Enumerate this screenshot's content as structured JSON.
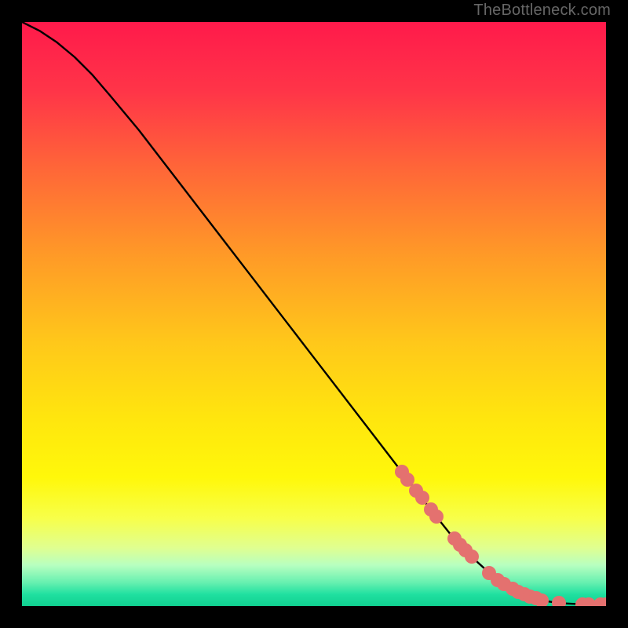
{
  "watermark": "TheBottleneck.com",
  "colors": {
    "page_bg": "#000000",
    "watermark": "#666666",
    "curve": "#000000",
    "marker": "#e4716f",
    "gradient_stops": [
      {
        "pct": 0,
        "color": "#ff1a4b"
      },
      {
        "pct": 12,
        "color": "#ff3548"
      },
      {
        "pct": 25,
        "color": "#ff6638"
      },
      {
        "pct": 40,
        "color": "#ff9a27"
      },
      {
        "pct": 55,
        "color": "#ffc81a"
      },
      {
        "pct": 68,
        "color": "#ffe60e"
      },
      {
        "pct": 78,
        "color": "#fff80a"
      },
      {
        "pct": 85,
        "color": "#f7ff4a"
      },
      {
        "pct": 90,
        "color": "#e0ff90"
      },
      {
        "pct": 93,
        "color": "#b8ffc0"
      },
      {
        "pct": 96,
        "color": "#66f0b0"
      },
      {
        "pct": 98,
        "color": "#20e0a0"
      },
      {
        "pct": 100,
        "color": "#10d090"
      }
    ]
  },
  "chart_data": {
    "type": "line",
    "title": "",
    "xlabel": "",
    "ylabel": "",
    "xlim": [
      0,
      100
    ],
    "ylim": [
      0,
      100
    ],
    "series": [
      {
        "name": "curve",
        "x": [
          0,
          3,
          6,
          9,
          12,
          15,
          20,
          25,
          30,
          35,
          40,
          45,
          50,
          55,
          60,
          65,
          70,
          74,
          76,
          78,
          80,
          82,
          84,
          86,
          88,
          90,
          92,
          94,
          96,
          98,
          100
        ],
        "y": [
          100,
          98.5,
          96.5,
          94,
          91,
          87.5,
          81.5,
          75,
          68.5,
          62,
          55.5,
          49,
          42.5,
          36,
          29.5,
          23,
          16.5,
          11.5,
          9.5,
          7.5,
          5.7,
          4.2,
          3.0,
          2.0,
          1.3,
          0.8,
          0.5,
          0.4,
          0.3,
          0.3,
          0.3
        ]
      }
    ],
    "markers": [
      {
        "x": 65,
        "y": 23.0
      },
      {
        "x": 66,
        "y": 21.7
      },
      {
        "x": 67.5,
        "y": 19.8
      },
      {
        "x": 68.5,
        "y": 18.5
      },
      {
        "x": 70,
        "y": 16.5
      },
      {
        "x": 71,
        "y": 15.3
      },
      {
        "x": 74,
        "y": 11.5
      },
      {
        "x": 75,
        "y": 10.5
      },
      {
        "x": 76,
        "y": 9.5
      },
      {
        "x": 77,
        "y": 8.5
      },
      {
        "x": 80,
        "y": 5.7
      },
      {
        "x": 81.5,
        "y": 4.5
      },
      {
        "x": 82.5,
        "y": 3.8
      },
      {
        "x": 84,
        "y": 3.0
      },
      {
        "x": 85,
        "y": 2.4
      },
      {
        "x": 86,
        "y": 2.0
      },
      {
        "x": 87,
        "y": 1.6
      },
      {
        "x": 88,
        "y": 1.3
      },
      {
        "x": 89,
        "y": 1.0
      },
      {
        "x": 92,
        "y": 0.5
      },
      {
        "x": 96,
        "y": 0.3
      },
      {
        "x": 97,
        "y": 0.3
      },
      {
        "x": 99,
        "y": 0.3
      },
      {
        "x": 100,
        "y": 0.3
      }
    ]
  }
}
